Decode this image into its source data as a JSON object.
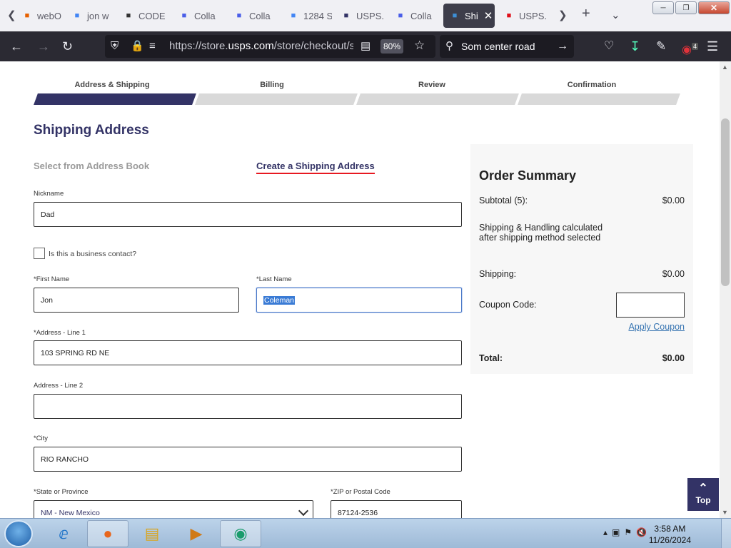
{
  "tabs": [
    {
      "title": "webO",
      "icon": "webo-icon",
      "color": "#e66000"
    },
    {
      "title": "jon w",
      "icon": "google-icon",
      "color": "#4285f4"
    },
    {
      "title": "CODE",
      "icon": "code-icon",
      "color": "#333"
    },
    {
      "title": "Colla",
      "icon": "search-tab-icon",
      "color": "#4a5ee8"
    },
    {
      "title": "Colla",
      "icon": "search-tab-icon",
      "color": "#4a5ee8"
    },
    {
      "title": "1284 S",
      "icon": "google-icon",
      "color": "#4285f4"
    },
    {
      "title": "USPS.",
      "icon": "usps-icon",
      "color": "#333366"
    },
    {
      "title": "Colla",
      "icon": "search-tab-icon",
      "color": "#4a5ee8"
    },
    {
      "title": "Shi",
      "icon": "usps-ship-icon",
      "color": "#3d8fd6",
      "active": true
    },
    {
      "title": "USPS.",
      "icon": "alert-icon",
      "color": "#e0101a"
    }
  ],
  "browser": {
    "url_prefix": "https://store.",
    "url_domain": "usps.com",
    "url_path": "/store/checkout/shi",
    "zoom": "80%",
    "search_text": "Som center road",
    "ext_badge": "4"
  },
  "steps": [
    "Address & Shipping",
    "Billing",
    "Review",
    "Confirmation"
  ],
  "page": {
    "title": "Shipping Address",
    "tab_address_book": "Select from Address Book",
    "tab_create": "Create a Shipping Address"
  },
  "form": {
    "nickname_label": "Nickname",
    "nickname": "Dad",
    "business_label": "Is this a business contact?",
    "first_label": "*First Name",
    "first": "Jon",
    "last_label": "*Last Name",
    "last": "Coleman",
    "addr1_label": "*Address - Line 1",
    "addr1": "103 SPRING RD NE",
    "addr2_label": "Address - Line 2",
    "addr2": "",
    "city_label": "*City",
    "city": "RIO RANCHO",
    "state_label": "*State or Province",
    "state": "NM - New Mexico",
    "zip_label": "*ZIP or Postal Code",
    "zip": "87124-2536"
  },
  "summary": {
    "title": "Order Summary",
    "subtotal_label": "Subtotal (5):",
    "subtotal": "$0.00",
    "shipping_note_1": "Shipping & Handling calculated",
    "shipping_note_2": "after shipping method selected",
    "shipping_label": "Shipping:",
    "shipping": "$0.00",
    "coupon_label": "Coupon Code:",
    "apply_label": "Apply Coupon",
    "total_label": "Total:",
    "total": "$0.00"
  },
  "top_button": "Top",
  "taskbar": {
    "time": "3:58 AM",
    "date": "11/26/2024"
  }
}
